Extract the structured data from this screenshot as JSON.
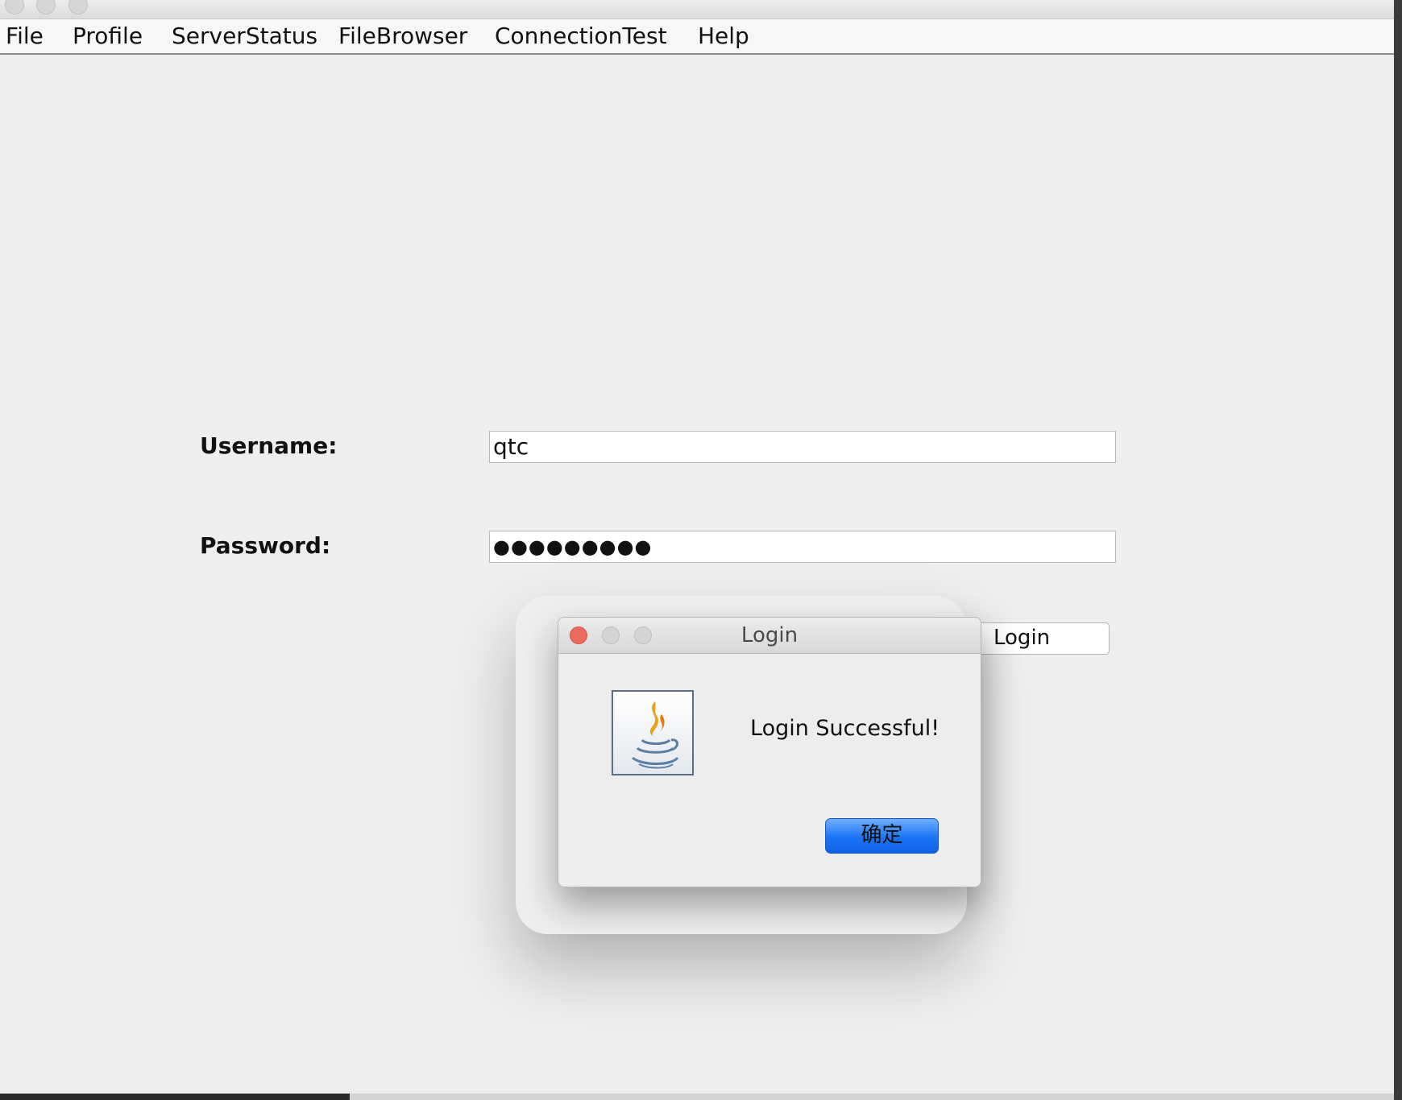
{
  "menubar": {
    "items": [
      {
        "label": "File"
      },
      {
        "label": "Profile"
      },
      {
        "label": "ServerStatus"
      },
      {
        "label": "FileBrowser"
      },
      {
        "label": "ConnectionTest"
      },
      {
        "label": "Help"
      }
    ]
  },
  "form": {
    "username_label": "Username:",
    "username_value": "qtc",
    "password_label": "Password:",
    "password_value": "●●●●●●●●●",
    "login_button": "Login"
  },
  "dialog": {
    "title": "Login",
    "message": "Login Successful!",
    "ok_button": "确定",
    "icon": "java-coffee-icon"
  },
  "colors": {
    "close_light": "#ed6a5e",
    "ok_button": "#1a73f5",
    "background": "#eeeeee"
  }
}
